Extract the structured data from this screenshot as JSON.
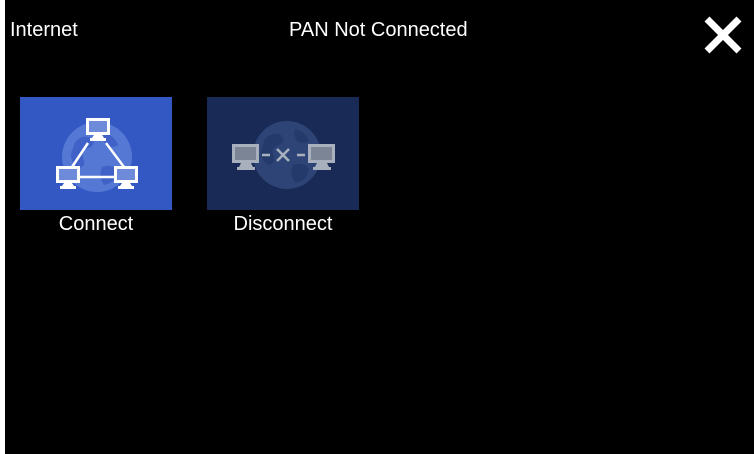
{
  "header": {
    "title": "Internet",
    "status": "PAN Not Connected",
    "close_icon": "close-icon"
  },
  "tiles": [
    {
      "label": "Connect",
      "icon": "network-connect-icon",
      "bg": "#3358c4",
      "enabled": true
    },
    {
      "label": "Disconnect",
      "icon": "network-disconnect-icon",
      "bg": "#182a55",
      "enabled": false
    }
  ],
  "colors": {
    "background": "#000000",
    "text": "#ffffff",
    "connect_tile": "#3358c4",
    "disconnect_tile": "#182a55"
  }
}
